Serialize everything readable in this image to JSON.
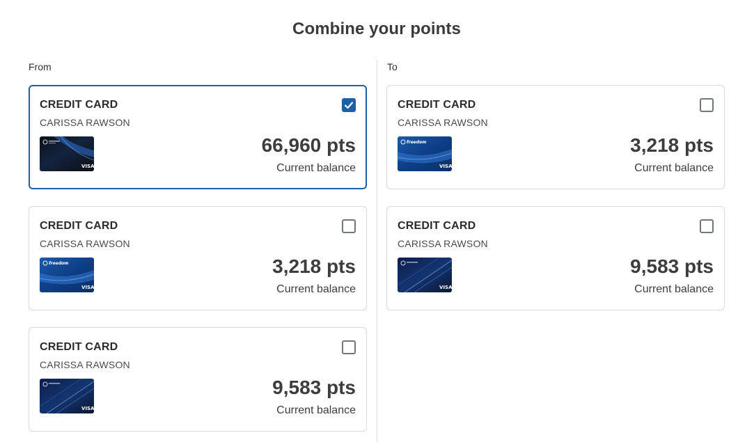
{
  "title": "Combine your points",
  "from": {
    "label": "From",
    "cards": [
      {
        "type": "CREDIT CARD",
        "holder": "CARISSA RAWSON",
        "points": "66,960 pts",
        "balance_label": "Current balance",
        "checked": true,
        "art": "sapphire-reserve-card-art"
      },
      {
        "type": "CREDIT CARD",
        "holder": "CARISSA RAWSON",
        "points": "3,218 pts",
        "balance_label": "Current balance",
        "checked": false,
        "art": "freedom-card-art"
      },
      {
        "type": "CREDIT CARD",
        "holder": "CARISSA RAWSON",
        "points": "9,583 pts",
        "balance_label": "Current balance",
        "checked": false,
        "art": "sapphire-preferred-card-art"
      }
    ]
  },
  "to": {
    "label": "To",
    "cards": [
      {
        "type": "CREDIT CARD",
        "holder": "CARISSA RAWSON",
        "points": "3,218 pts",
        "balance_label": "Current balance",
        "checked": false,
        "art": "freedom-card-art"
      },
      {
        "type": "CREDIT CARD",
        "holder": "CARISSA RAWSON",
        "points": "9,583 pts",
        "balance_label": "Current balance",
        "checked": false,
        "art": "sapphire-preferred-card-art"
      }
    ]
  },
  "colors": {
    "accent": "#1f5fa8",
    "border": "#d9d9d9",
    "text": "#3d3d3d"
  }
}
